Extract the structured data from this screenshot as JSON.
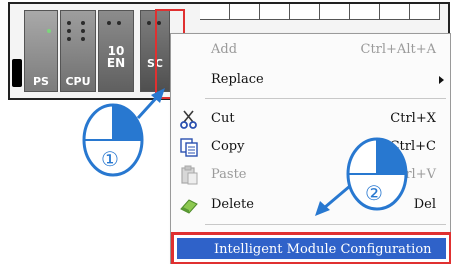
{
  "rack": {
    "modules": [
      {
        "label": "PS"
      },
      {
        "label": "CPU"
      },
      {
        "label": "10\nEN"
      },
      {
        "label": "SC"
      }
    ]
  },
  "context_menu": {
    "items": [
      {
        "label": "Add",
        "shortcut": "Ctrl+Alt+A",
        "enabled": false,
        "icon": "none"
      },
      {
        "label": "Replace",
        "shortcut": "",
        "enabled": true,
        "icon": "none",
        "has_submenu": true
      },
      {
        "label": "Cut",
        "shortcut": "Ctrl+X",
        "enabled": true,
        "icon": "scissors-icon"
      },
      {
        "label": "Copy",
        "shortcut": "Ctrl+C",
        "enabled": true,
        "icon": "copy-icon"
      },
      {
        "label": "Paste",
        "shortcut": "Ctrl+V",
        "enabled": false,
        "icon": "paste-icon"
      },
      {
        "label": "Delete",
        "shortcut": "Del",
        "enabled": true,
        "icon": "eraser-icon"
      }
    ],
    "highlighted_item": {
      "label": "Intelligent Module Configuration"
    }
  },
  "step_markers": {
    "step1": "①",
    "step2": "②"
  },
  "colors": {
    "highlight_border": "#e03030",
    "selection_bg": "#2f62c9",
    "mouse_blue": "#2878d0"
  }
}
